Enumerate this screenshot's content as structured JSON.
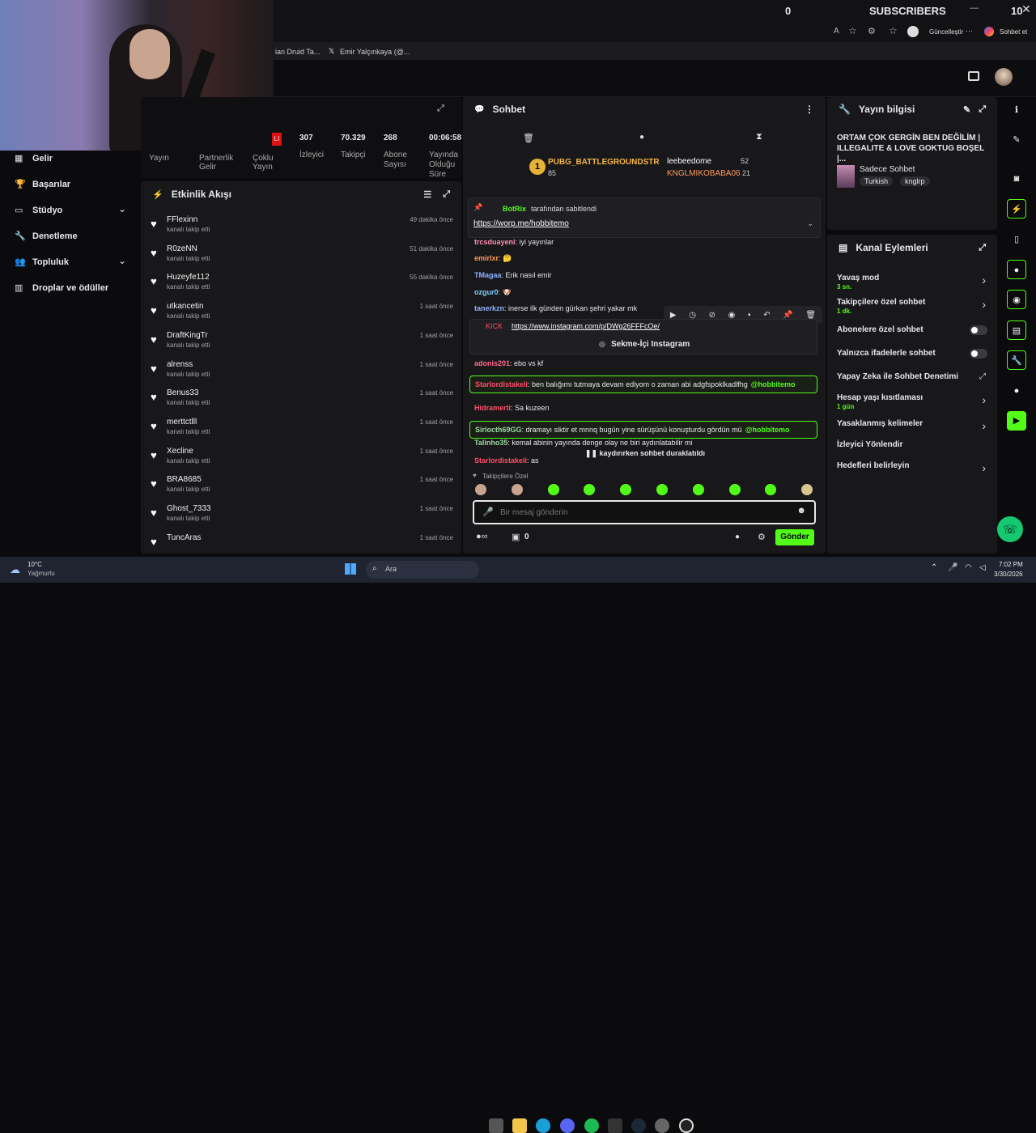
{
  "overlay": {
    "counter": "0",
    "subscribers_label": "SUBSCRIBERS",
    "right_value": "10"
  },
  "browser": {
    "update_label": "Güncelleştir",
    "sohbet_label": "Sohbet et",
    "tabs": [
      "ian Druid Ta...",
      "Emir Yalçınkaya (@..."
    ]
  },
  "stats": {
    "values": [
      "307",
      "70.329",
      "268",
      "00:06:58"
    ],
    "labels": [
      "İzleyici",
      "Takipçi",
      "Abone Sayısı",
      "Yayında Olduğu Süre"
    ],
    "left_labels": [
      "Yayın",
      "Partnerlik Gelir",
      "Çoklu Yayın"
    ],
    "red_badge": "LI"
  },
  "sidebar": {
    "items": [
      {
        "label": "Gelir",
        "icon": "revenue-icon"
      },
      {
        "label": "Başarılar",
        "icon": "trophy-icon"
      },
      {
        "label": "Stüdyo",
        "icon": "studio-icon",
        "chevron": true
      },
      {
        "label": "Denetleme",
        "icon": "wrench-icon"
      },
      {
        "label": "Topluluk",
        "icon": "community-icon",
        "chevron": true
      },
      {
        "label": "Droplar ve ödüller",
        "icon": "drops-icon"
      }
    ]
  },
  "activity": {
    "title": "Etkinlik Akışı",
    "items": [
      {
        "name": "FFlexinn",
        "sub": "kanalı takip etti",
        "time": "49 dakika önce"
      },
      {
        "name": "R0zeNN",
        "sub": "kanalı takip etti",
        "time": "51 dakika önce"
      },
      {
        "name": "Huzeyfe112",
        "sub": "kanalı takip etti",
        "time": "55 dakika önce"
      },
      {
        "name": "utkancetin",
        "sub": "kanalı takip etti",
        "time": "1 saat önce"
      },
      {
        "name": "DraftKingTr",
        "sub": "kanalı takip etti",
        "time": "1 saat önce"
      },
      {
        "name": "alrenss",
        "sub": "kanalı takip etti",
        "time": "1 saat önce"
      },
      {
        "name": "Benus33",
        "sub": "kanalı takip etti",
        "time": "1 saat önce"
      },
      {
        "name": "merttctlll",
        "sub": "kanalı takip etti",
        "time": "1 saat önce"
      },
      {
        "name": "Xecline",
        "sub": "kanalı takip etti",
        "time": "1 saat önce"
      },
      {
        "name": "BRA8685",
        "sub": "kanalı takip etti",
        "time": "1 saat önce"
      },
      {
        "name": "Ghost_7333",
        "sub": "kanalı takip etti",
        "time": "1 saat önce"
      },
      {
        "name": "TuncAras",
        "sub": "",
        "time": "1 saat önce"
      }
    ]
  },
  "chat": {
    "title": "Sohbet",
    "leaderboard": [
      {
        "rank": "1",
        "name": "PUBG_BATTLEGROUNDSTR",
        "value": "85"
      },
      {
        "name": "leebeedome",
        "value": "52"
      },
      {
        "name": "KNGLMIKOBABA06",
        "value": "21"
      }
    ],
    "pinned": {
      "by": "BotRix",
      "by_suffix": "tarafından sabitlendi",
      "link": "https://worp.me/hobbitemo"
    },
    "messages": [
      {
        "user": "trcsduayeni",
        "color": "#ff8fb1",
        "text": "iyi yayınlar"
      },
      {
        "user": "emirlxr",
        "color": "#ff9c5b",
        "text": "🤔"
      },
      {
        "user": "TMagaa",
        "color": "#8fb3ff",
        "text": "Erik nasıl emir"
      },
      {
        "user": "ozgur0",
        "color": "#7fd0ff",
        "text": "🐶"
      },
      {
        "user": "tanerkzn",
        "color": "#8fb3ff",
        "text": "inerse ilk günden gürkan şehri yakar mk"
      },
      {
        "user": "KICK",
        "color": "#ff4d6a",
        "text": "https://www.instagram.com/p/DWg26FFFcOe/"
      },
      {
        "user": "adonis201",
        "color": "#ff6b8a",
        "text": "ebo vs kf"
      },
      {
        "user": "Starlordistakeli",
        "color": "#ff4d6a",
        "text": "ben balığımı tutmaya devam ediyom o zaman abi adgfspoklkadlfhg"
      },
      {
        "user": "Hidramerti",
        "color": "#ff4d6a",
        "text": "Sa kuzeen"
      },
      {
        "user": "Sirlocth69GG",
        "color": "#9ad9a0",
        "text": "dramayı siktir et mnnq bugün yine sürüşünü konuşturdu gördün mü"
      },
      {
        "user": "Talinho35",
        "color": "#9ad9a0",
        "text": "kemal abinin yayında denge olay ne biri aydınlatabilir mi"
      },
      {
        "user": "Starlordistakeli",
        "color": "#ff4d6a",
        "text": "as"
      }
    ],
    "mention": "@hobbitemo",
    "instagram_label": "Sekme-İçi Instagram",
    "paused_label": "kaydırırken sohbet duraklatıldı",
    "followers_only": "Takipçilere Özel",
    "input_placeholder": "Bir mesaj gönderin",
    "send_label": "Gönder",
    "gift_count": "0"
  },
  "info": {
    "title": "Yayın bilgisi",
    "stream_title": "ORTAM ÇOK GERGİN BEN DEĞİLİM | ILLEGALITE & LOVE GOKTUG BOŞEL |...",
    "category": "Sadece Sohbet",
    "tags": [
      "Turkish",
      "knglrp"
    ]
  },
  "actions": {
    "title": "Kanal Eylemleri",
    "items": [
      {
        "label": "Yavaş mod",
        "sub": "3 sn.",
        "type": "chevron"
      },
      {
        "label": "Takipçilere özel sohbet",
        "sub": "1 dk.",
        "type": "chevron"
      },
      {
        "label": "Abonelere özel sohbet",
        "sub": "",
        "type": "toggle"
      },
      {
        "label": "Yalnızca ifadelerle sohbet",
        "sub": "",
        "type": "toggle"
      },
      {
        "label": "Yapay Zeka ile Sohbet Denetimi",
        "sub": "",
        "type": "external"
      },
      {
        "label": "Hesap yaşı kısıtlaması",
        "sub": "1 gün",
        "type": "chevron"
      },
      {
        "label": "Yasaklanmış kelimeler",
        "sub": "",
        "type": "chevron"
      },
      {
        "label": "İzleyici Yönlendir",
        "sub": "",
        "type": "none"
      },
      {
        "label": "Hedefleri belirleyin",
        "sub": "",
        "type": "chevron"
      }
    ]
  },
  "taskbar": {
    "temp": "10°C",
    "weather": "Yağmurlu",
    "search": "Ara",
    "time": "7:02 PM",
    "date": "3/30/2026"
  },
  "colors": {
    "accent": "#53fc18",
    "panel": "#18181b",
    "bg": "#0b0b0d"
  }
}
